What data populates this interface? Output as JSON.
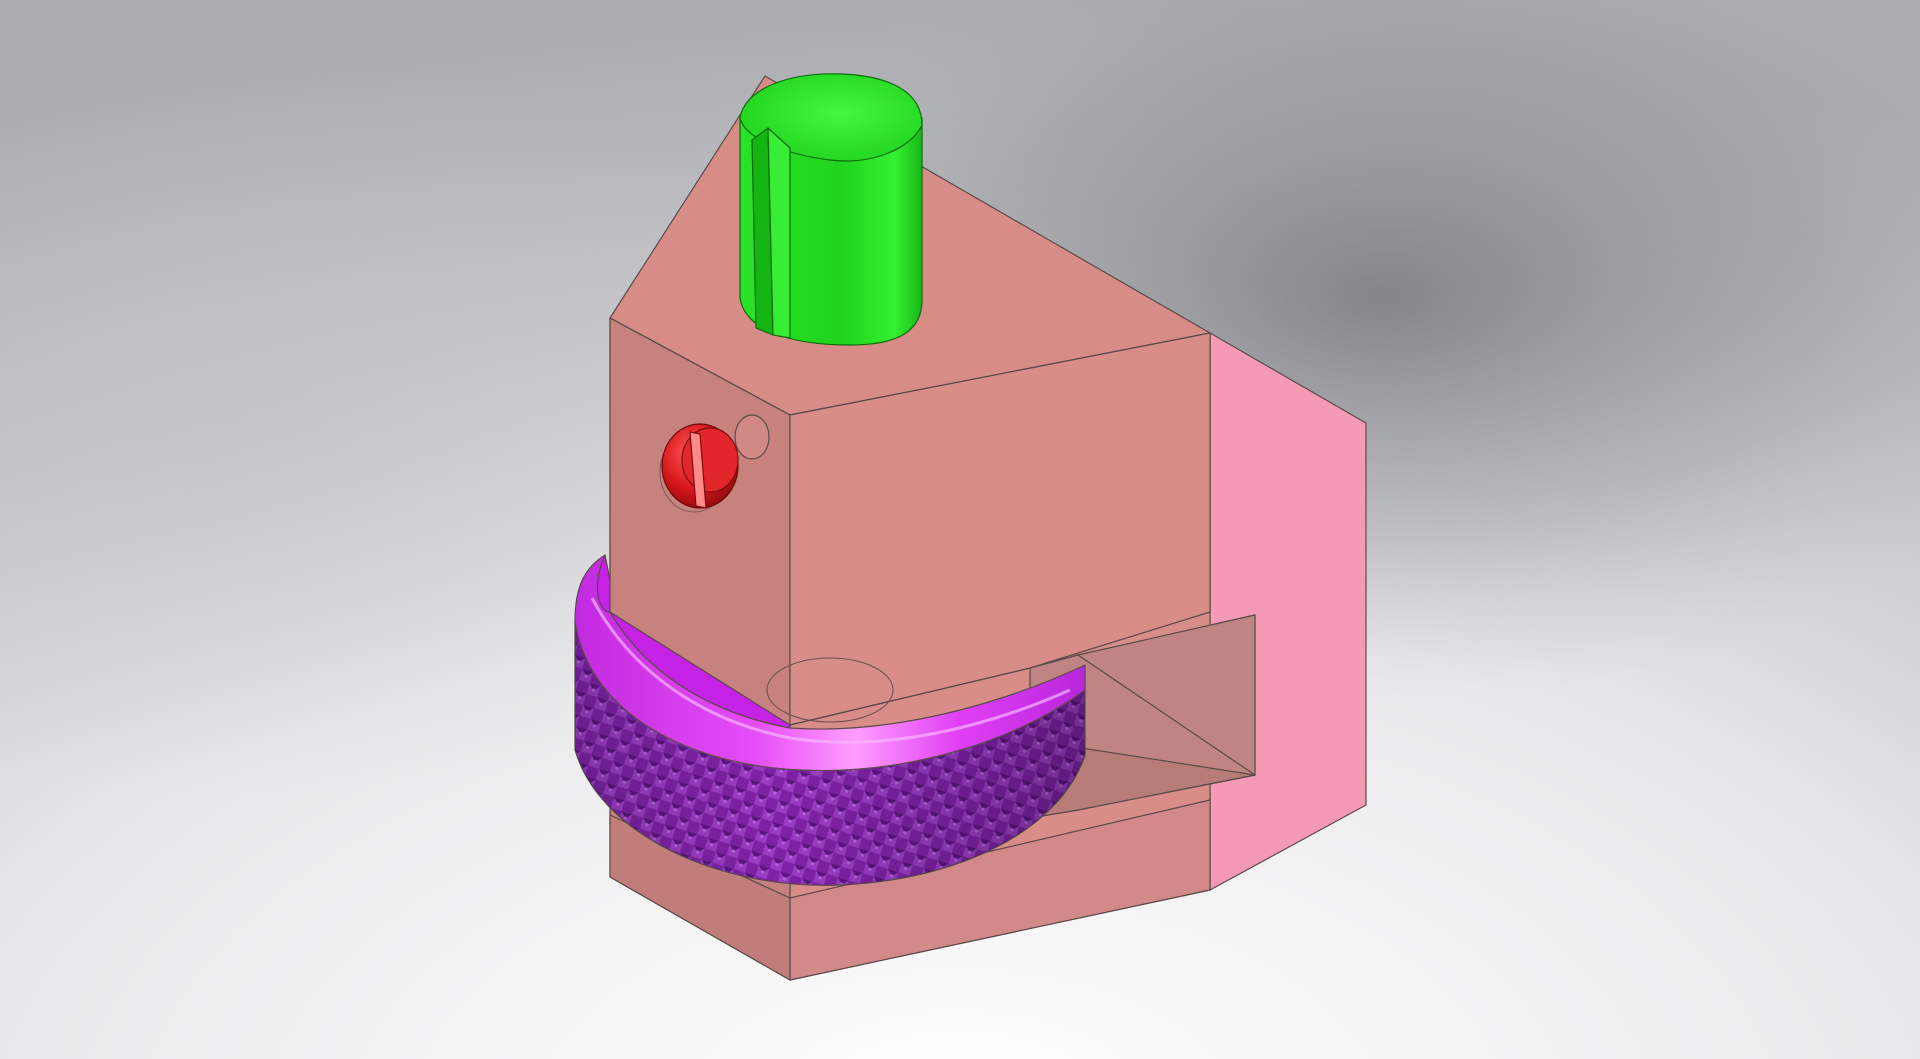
{
  "viewport": {
    "background_top": "#aeb0b4",
    "background_mid": "#c9cacd",
    "background_bottom": "#f6f6f7",
    "background_shadow": "#7a7b7e"
  },
  "model": {
    "body_color": "#d98e88",
    "body_side_color": "#c4807c",
    "body_top_color": "#d88b86",
    "body_right_color": "#f59ab4",
    "knob_color": "#22e01f",
    "knob_highlight": "#5cf55a",
    "knob_shadow": "#12a914",
    "wheel_color": "#8b2db3",
    "wheel_rim_color": "#e233f5",
    "wheel_rim_highlight": "#ff9cff",
    "screw_color": "#d9151b",
    "screw_highlight": "#ff6d6d",
    "edge_color": "#5a4a4a"
  }
}
